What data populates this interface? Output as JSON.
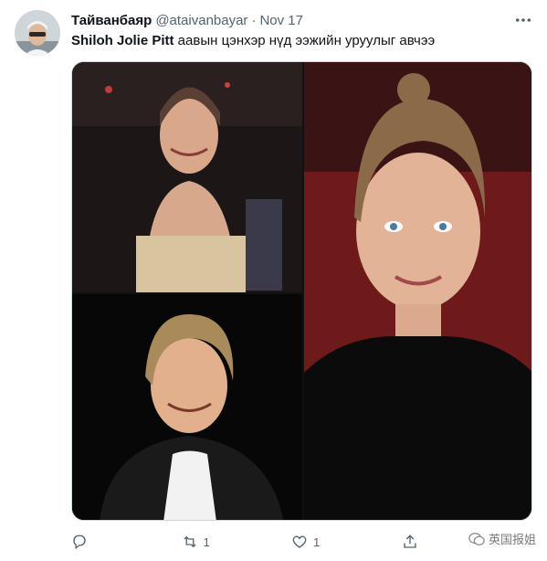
{
  "tweet": {
    "display_name": "Тайванбаяр",
    "handle": "@ataivanbayar",
    "separator": "·",
    "date": "Nov 17",
    "text_strong": "Shiloh Jolie Pitt",
    "text_rest": " аавын цэнхэр нүд ээжийн уруулыг авчээ",
    "retweet_count": "1",
    "like_count": "1"
  },
  "watermark": {
    "text": "英国报姐"
  },
  "icons": {
    "more": "more-horizontal-icon",
    "reply": "reply-icon",
    "retweet": "retweet-icon",
    "like": "heart-icon",
    "share": "share-icon"
  },
  "colors": {
    "text": "#0f1419",
    "secondary": "#536471",
    "border": "#cfd9de"
  }
}
